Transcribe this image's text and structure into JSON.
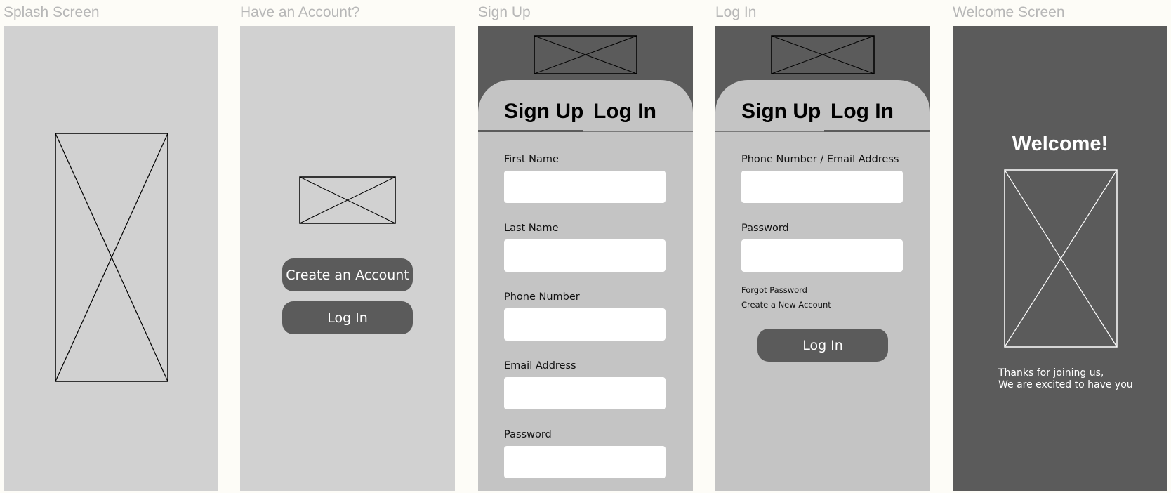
{
  "frames": {
    "splash": {
      "title": "Splash Screen"
    },
    "have_account": {
      "title": "Have an Account?",
      "create_account_label": "Create an Account",
      "login_label": "Log In"
    },
    "signup": {
      "title": "Sign Up",
      "tabs": [
        "Sign Up",
        "Log In"
      ],
      "active_tab": "Sign Up",
      "fields": [
        {
          "label": "First Name",
          "value": ""
        },
        {
          "label": "Last Name",
          "value": ""
        },
        {
          "label": "Phone Number",
          "value": ""
        },
        {
          "label": "Email Address",
          "value": ""
        },
        {
          "label": "Password",
          "value": ""
        }
      ]
    },
    "login": {
      "title": "Log In",
      "tabs": [
        "Sign Up",
        "Log In"
      ],
      "active_tab": "Log In",
      "fields": [
        {
          "label": "Phone Number / Email Address",
          "value": ""
        },
        {
          "label": "Password",
          "value": ""
        }
      ],
      "forgot_password": "Forgot Password",
      "create_new_account": "Create a New Account",
      "login_button": "Log In"
    },
    "welcome": {
      "title": "Welcome Screen",
      "heading": "Welcome!",
      "message_line1": "Thanks for joining us,",
      "message_line2": "We are excited to have you"
    }
  },
  "colors": {
    "page_background": "#fdfcf7",
    "frame_light": "#d1d1d1",
    "frame_panel": "#c4c4c4",
    "frame_dark": "#5b5b5b",
    "frame_label": "#b7b7b7",
    "input_background": "#ffffff"
  },
  "icons": {
    "placeholder": "image-placeholder-icon"
  }
}
